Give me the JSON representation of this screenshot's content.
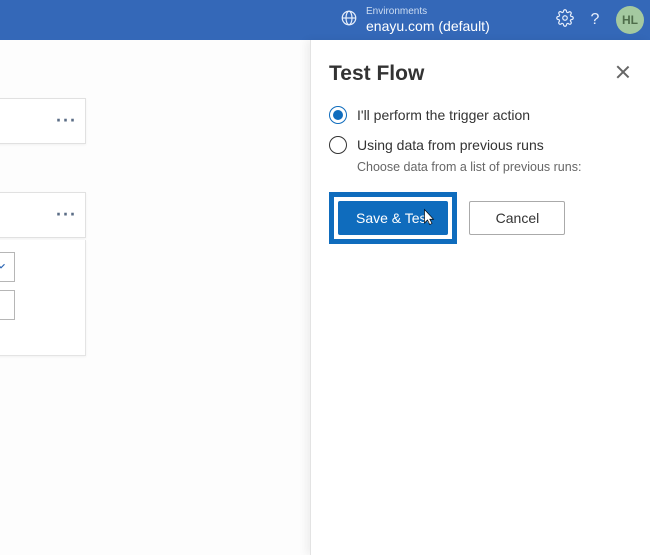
{
  "header": {
    "env_label": "Environments",
    "env_name": "enayu.com (default)",
    "avatar_initials": "HL"
  },
  "panel": {
    "title": "Test Flow",
    "options": [
      {
        "label": "I'll perform the trigger action"
      },
      {
        "label": "Using data from previous runs"
      }
    ],
    "hint": "Choose data from a list of previous runs:",
    "primary_button": "Save & Test",
    "secondary_button": "Cancel"
  }
}
